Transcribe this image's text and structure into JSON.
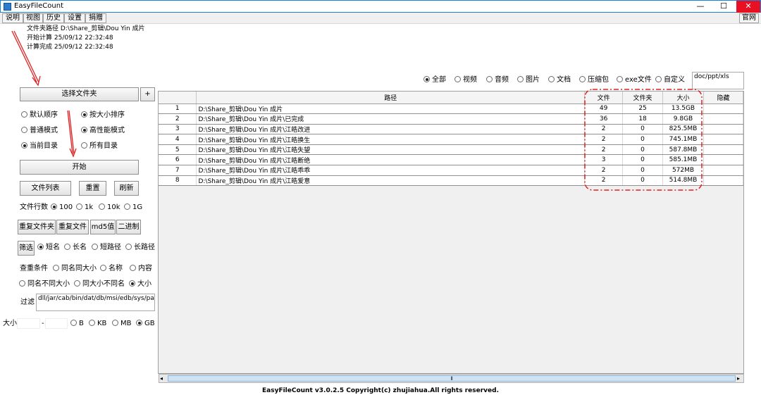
{
  "window": {
    "title": "EasyFileCount",
    "minimize": "—",
    "maximize": "☐",
    "close": "✕"
  },
  "menu": [
    "说明",
    "视图",
    "历史",
    "设置",
    "捐赠"
  ],
  "site_button": "官网",
  "info": {
    "folder_path": "文件夹路径 D:\\Share_剪辑\\Dou Yin 成片",
    "start_time": "开始计算 25/09/12 22:32:48",
    "end_time": "计算完成 25/09/12 22:32:48"
  },
  "left": {
    "select_folder": "选择文件夹",
    "plus": "+",
    "sort_options": [
      {
        "label": "默认顺序",
        "selected": false
      },
      {
        "label": "按大小排序",
        "selected": true
      }
    ],
    "mode_options": [
      {
        "label": "普通模式",
        "selected": false
      },
      {
        "label": "高性能模式",
        "selected": true
      }
    ],
    "dir_options": [
      {
        "label": "当前目录",
        "selected": true
      },
      {
        "label": "所有目录",
        "selected": false
      }
    ],
    "start": "开始",
    "file_list": "文件列表",
    "reset": "重置",
    "refresh": "刷新",
    "rows_label": "文件行数",
    "rows_options": [
      {
        "label": "100",
        "selected": true
      },
      {
        "label": "1k",
        "selected": false
      },
      {
        "label": "10k",
        "selected": false
      },
      {
        "label": "1G",
        "selected": false
      }
    ],
    "dup_folder": "重复文件夹",
    "dup_file": "重复文件",
    "md5": "md5值",
    "binary": "二进制",
    "filter_btn": "筛选",
    "name_options": [
      {
        "label": "短名",
        "selected": true
      },
      {
        "label": "长名",
        "selected": false
      },
      {
        "label": "短路径",
        "selected": false
      },
      {
        "label": "长路径",
        "selected": false
      }
    ],
    "dup_cond_label": "查重条件",
    "dup_cond_options": [
      {
        "label": "同名同大小",
        "selected": false
      },
      {
        "label": "名称",
        "selected": false
      },
      {
        "label": "内容",
        "selected": false
      }
    ],
    "dup_cond_options2": [
      {
        "label": "同名不同大小",
        "selected": false
      },
      {
        "label": "同大小不同名",
        "selected": false
      },
      {
        "label": "大小",
        "selected": true
      }
    ],
    "filter_label": "过滤",
    "filter_value": "dll/jar/cab/bin/dat/db/msi/edb/sys/pak/jsa",
    "size_label": "大小",
    "size_sep": "-",
    "size_min": "",
    "size_max": "",
    "size_units": [
      {
        "label": "B",
        "selected": false
      },
      {
        "label": "KB",
        "selected": false
      },
      {
        "label": "MB",
        "selected": false
      },
      {
        "label": "GB",
        "selected": true
      }
    ]
  },
  "type_filter": [
    {
      "label": "全部",
      "selected": true
    },
    {
      "label": "视频",
      "selected": false
    },
    {
      "label": "音频",
      "selected": false
    },
    {
      "label": "图片",
      "selected": false
    },
    {
      "label": "文档",
      "selected": false
    },
    {
      "label": "压缩包",
      "selected": false
    },
    {
      "label": "exe文件",
      "selected": false
    },
    {
      "label": "自定义",
      "selected": false
    }
  ],
  "custom_ext": "doc/ppt/xls",
  "table": {
    "headers": [
      "",
      "路径",
      "文件",
      "文件夹",
      "大小",
      "隐藏"
    ],
    "rows": [
      {
        "idx": "1",
        "path": "D:\\Share_剪辑\\Dou Yin 成片",
        "files": "49",
        "folders": "25",
        "size": "13.5GB",
        "hidden": ""
      },
      {
        "idx": "2",
        "path": "D:\\Share_剪辑\\Dou Yin 成片\\已完成",
        "files": "36",
        "folders": "18",
        "size": "9.8GB",
        "hidden": ""
      },
      {
        "idx": "3",
        "path": "D:\\Share_剪辑\\Dou Yin 成片\\江皓改进",
        "files": "2",
        "folders": "0",
        "size": "825.5MB",
        "hidden": ""
      },
      {
        "idx": "4",
        "path": "D:\\Share_剪辑\\Dou Yin 成片\\江皓换生",
        "files": "2",
        "folders": "0",
        "size": "745.1MB",
        "hidden": ""
      },
      {
        "idx": "5",
        "path": "D:\\Share_剪辑\\Dou Yin 成片\\江皓失望",
        "files": "2",
        "folders": "0",
        "size": "587.8MB",
        "hidden": ""
      },
      {
        "idx": "6",
        "path": "D:\\Share_剪辑\\Dou Yin 成片\\江皓断绝",
        "files": "3",
        "folders": "0",
        "size": "585.1MB",
        "hidden": ""
      },
      {
        "idx": "7",
        "path": "D:\\Share_剪辑\\Dou Yin 成片\\江皓乖乖",
        "files": "2",
        "folders": "0",
        "size": "572MB",
        "hidden": ""
      },
      {
        "idx": "8",
        "path": "D:\\Share_剪辑\\Dou Yin 成片\\江皓爱意",
        "files": "2",
        "folders": "0",
        "size": "514.8MB",
        "hidden": ""
      }
    ]
  },
  "scroll_grip": "⦀",
  "scroll_left": "◂",
  "scroll_right": "▸",
  "footer": "EasyFileCount v3.0.2.5 Copyright(c) zhujiahua.All rights reserved.",
  "colors": {
    "annotation_red": "#e02020",
    "title_border": "#1883d7",
    "close_red": "#e81123"
  }
}
